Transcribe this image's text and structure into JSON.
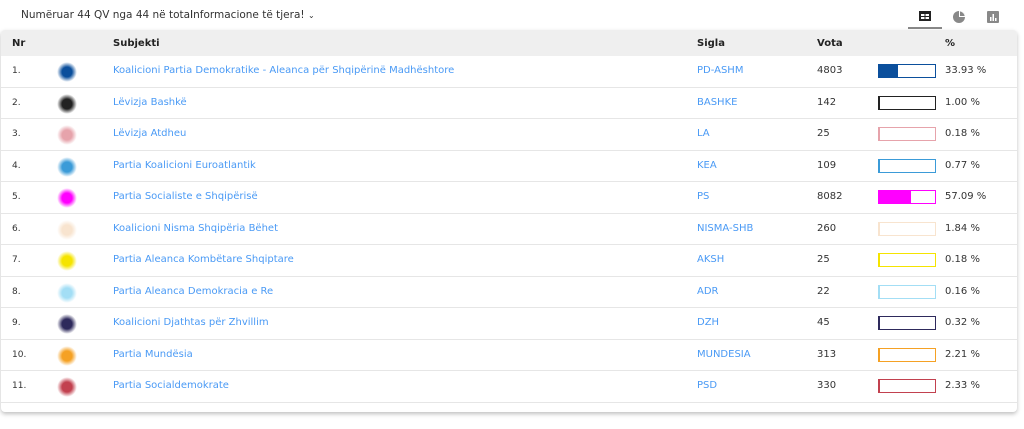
{
  "top": {
    "count_text": "Numëruar 44 QV nga 44 në total",
    "more_label": "Informacione të tjera!",
    "more_icon": "chevron-down-icon",
    "views": [
      {
        "name": "table-view",
        "icon": "table-icon",
        "active": true
      },
      {
        "name": "pie-view",
        "icon": "pie-chart-icon",
        "active": false
      },
      {
        "name": "bar-view",
        "icon": "bar-chart-icon",
        "active": false
      }
    ]
  },
  "table": {
    "headers": {
      "nr": "Nr",
      "subject": "Subjekti",
      "sigla": "Sigla",
      "vota": "Vota",
      "pct": "%"
    },
    "rows": [
      {
        "nr": "1.",
        "subject": "Koalicioni Partia Demokratike - Aleanca për Shqipërinë Madhështore",
        "sigla": "PD-ASHM",
        "votes": "4803",
        "pct": "33.93 %",
        "value": 33.93,
        "color": "#0b4f9c"
      },
      {
        "nr": "2.",
        "subject": "Lëvizja Bashkë",
        "sigla": "BASHKE",
        "votes": "142",
        "pct": "1.00 %",
        "value": 1.0,
        "color": "#222222"
      },
      {
        "nr": "3.",
        "subject": "Lëvizja Atdheu",
        "sigla": "LA",
        "votes": "25",
        "pct": "0.18 %",
        "value": 0.18,
        "color": "#e6a3ab"
      },
      {
        "nr": "4.",
        "subject": "Partia Koalicioni Euroatlantik",
        "sigla": "KEA",
        "votes": "109",
        "pct": "0.77 %",
        "value": 0.77,
        "color": "#3b9bd8"
      },
      {
        "nr": "5.",
        "subject": "Partia Socialiste e Shqipërisë",
        "sigla": "PS",
        "votes": "8082",
        "pct": "57.09 %",
        "value": 57.09,
        "color": "#ff00ff"
      },
      {
        "nr": "6.",
        "subject": "Koalicioni Nisma Shqipëria Bëhet",
        "sigla": "NISMA-SHB",
        "votes": "260",
        "pct": "1.84 %",
        "value": 1.84,
        "color": "#f8e4cf"
      },
      {
        "nr": "7.",
        "subject": "Partia Aleanca Kombëtare Shqiptare",
        "sigla": "AKSH",
        "votes": "25",
        "pct": "0.18 %",
        "value": 0.18,
        "color": "#f5e400"
      },
      {
        "nr": "8.",
        "subject": "Partia Aleanca Demokracia e Re",
        "sigla": "ADR",
        "votes": "22",
        "pct": "0.16 %",
        "value": 0.16,
        "color": "#a3def5"
      },
      {
        "nr": "9.",
        "subject": "Koalicioni Djathtas për Zhvillim",
        "sigla": "DZH",
        "votes": "45",
        "pct": "0.32 %",
        "value": 0.32,
        "color": "#2e2a5c"
      },
      {
        "nr": "10.",
        "subject": "Partia Mundësia",
        "sigla": "MUNDESIA",
        "votes": "313",
        "pct": "2.21 %",
        "value": 2.21,
        "color": "#f5a124"
      },
      {
        "nr": "11.",
        "subject": "Partia Socialdemokrate",
        "sigla": "PSD",
        "votes": "330",
        "pct": "2.33 %",
        "value": 2.33,
        "color": "#c2414f"
      }
    ]
  }
}
